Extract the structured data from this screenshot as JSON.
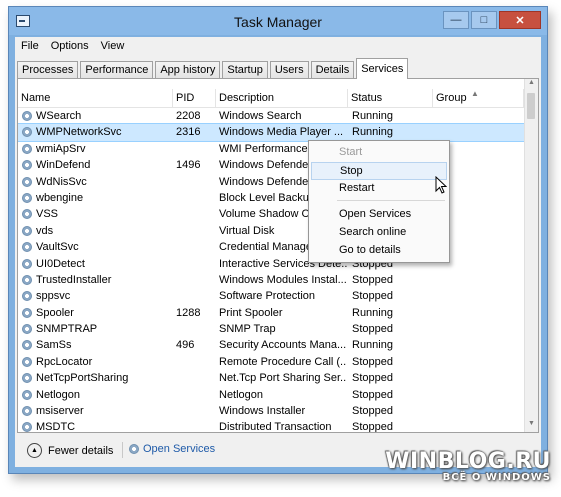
{
  "window": {
    "title": "Task Manager"
  },
  "menu": [
    "File",
    "Options",
    "View"
  ],
  "tabs": [
    "Processes",
    "Performance",
    "App history",
    "Startup",
    "Users",
    "Details",
    "Services"
  ],
  "active_tab": "Services",
  "columns": {
    "name": "Name",
    "pid": "PID",
    "description": "Description",
    "status": "Status",
    "group": "Group"
  },
  "rows": [
    {
      "name": "WSearch",
      "pid": "2208",
      "description": "Windows Search",
      "status": "Running",
      "group": ""
    },
    {
      "name": "WMPNetworkSvc",
      "pid": "2316",
      "description": "Windows Media Player ...",
      "status": "Running",
      "group": "",
      "selected": true
    },
    {
      "name": "wmiApSrv",
      "pid": "",
      "description": "WMI Performance A",
      "status": "",
      "group": ""
    },
    {
      "name": "WinDefend",
      "pid": "1496",
      "description": "Windows Defender",
      "status": "",
      "group": ""
    },
    {
      "name": "WdNisSvc",
      "pid": "",
      "description": "Windows Defender",
      "status": "",
      "group": ""
    },
    {
      "name": "wbengine",
      "pid": "",
      "description": "Block Level Backup",
      "status": "",
      "group": ""
    },
    {
      "name": "VSS",
      "pid": "",
      "description": "Volume Shadow Co",
      "status": "",
      "group": ""
    },
    {
      "name": "vds",
      "pid": "",
      "description": "Virtual Disk",
      "status": "",
      "group": ""
    },
    {
      "name": "VaultSvc",
      "pid": "",
      "description": "Credential Manager",
      "status": "",
      "group": ""
    },
    {
      "name": "UI0Detect",
      "pid": "",
      "description": "Interactive Services Dete...",
      "status": "Stopped",
      "group": ""
    },
    {
      "name": "TrustedInstaller",
      "pid": "",
      "description": "Windows Modules Instal...",
      "status": "Stopped",
      "group": ""
    },
    {
      "name": "sppsvc",
      "pid": "",
      "description": "Software Protection",
      "status": "Stopped",
      "group": ""
    },
    {
      "name": "Spooler",
      "pid": "1288",
      "description": "Print Spooler",
      "status": "Running",
      "group": ""
    },
    {
      "name": "SNMPTRAP",
      "pid": "",
      "description": "SNMP Trap",
      "status": "Stopped",
      "group": ""
    },
    {
      "name": "SamSs",
      "pid": "496",
      "description": "Security Accounts Mana...",
      "status": "Running",
      "group": ""
    },
    {
      "name": "RpcLocator",
      "pid": "",
      "description": "Remote Procedure Call (...",
      "status": "Stopped",
      "group": ""
    },
    {
      "name": "NetTcpPortSharing",
      "pid": "",
      "description": "Net.Tcp Port Sharing Ser...",
      "status": "Stopped",
      "group": ""
    },
    {
      "name": "Netlogon",
      "pid": "",
      "description": "Netlogon",
      "status": "Stopped",
      "group": ""
    },
    {
      "name": "msiserver",
      "pid": "",
      "description": "Windows Installer",
      "status": "Stopped",
      "group": ""
    },
    {
      "name": "MSDTC",
      "pid": "",
      "description": "Distributed Transaction",
      "status": "Stopped",
      "group": ""
    }
  ],
  "context_menu": {
    "start": "Start",
    "stop": "Stop",
    "restart": "Restart",
    "open_services": "Open Services",
    "search_online": "Search online",
    "go_to_details": "Go to details"
  },
  "footer": {
    "fewer_details": "Fewer details",
    "open_services": "Open Services"
  },
  "watermark": {
    "line1": "WINBLOG.RU",
    "line2": "ВСЁ О WINDOWS"
  }
}
